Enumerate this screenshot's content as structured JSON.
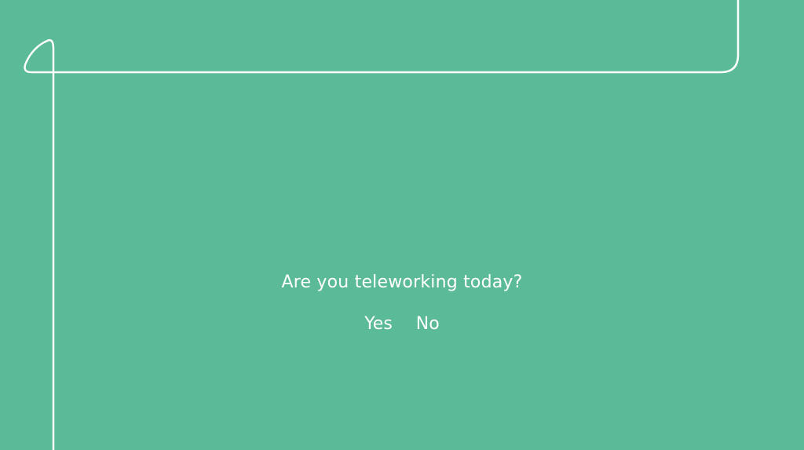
{
  "survey": {
    "question": "Are you teleworking today?",
    "answers": {
      "yes": "Yes",
      "no": "No"
    }
  },
  "colors": {
    "background": "#5bba97",
    "foreground": "#ffffff"
  }
}
